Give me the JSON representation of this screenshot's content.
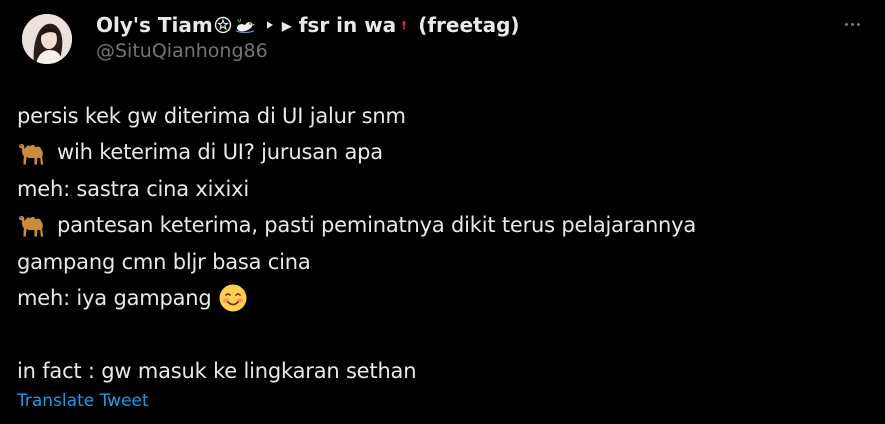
{
  "author": {
    "display_name_part1": "Oly's Tiam",
    "display_name_part2": "▸ fsr in wa",
    "display_name_part3": "(freetag)",
    "handle": "@SituQianhong86",
    "name_icons": [
      "medal-icon",
      "duck-icon",
      "play-arrow-icon",
      "exclamation-icon"
    ]
  },
  "tweet": {
    "lines": [
      {
        "emoji": "",
        "text": "persis kek gw diterima di UI jalur snm"
      },
      {
        "emoji": "camel",
        "text": "wih keterima di UI? jurusan apa"
      },
      {
        "emoji": "",
        "text": "meh: sastra cina xixixi"
      },
      {
        "emoji": "camel",
        "text": "pantesan keterima, pasti peminatnya dikit terus pelajarannya"
      },
      {
        "emoji": "",
        "text": "gampang cmn bljr basa cina"
      },
      {
        "emoji": "blush-after",
        "text": "meh: iya gampang"
      },
      {
        "emoji": "",
        "text": ""
      },
      {
        "emoji": "",
        "text": "in fact : gw masuk ke lingkaran sethan"
      }
    ]
  },
  "actions": {
    "translate_label": "Translate Tweet",
    "more_icon": "more-options-icon"
  },
  "colors": {
    "background": "#000000",
    "text": "#e7e9ea",
    "secondary": "#71767b",
    "link": "#1d9bf0"
  }
}
